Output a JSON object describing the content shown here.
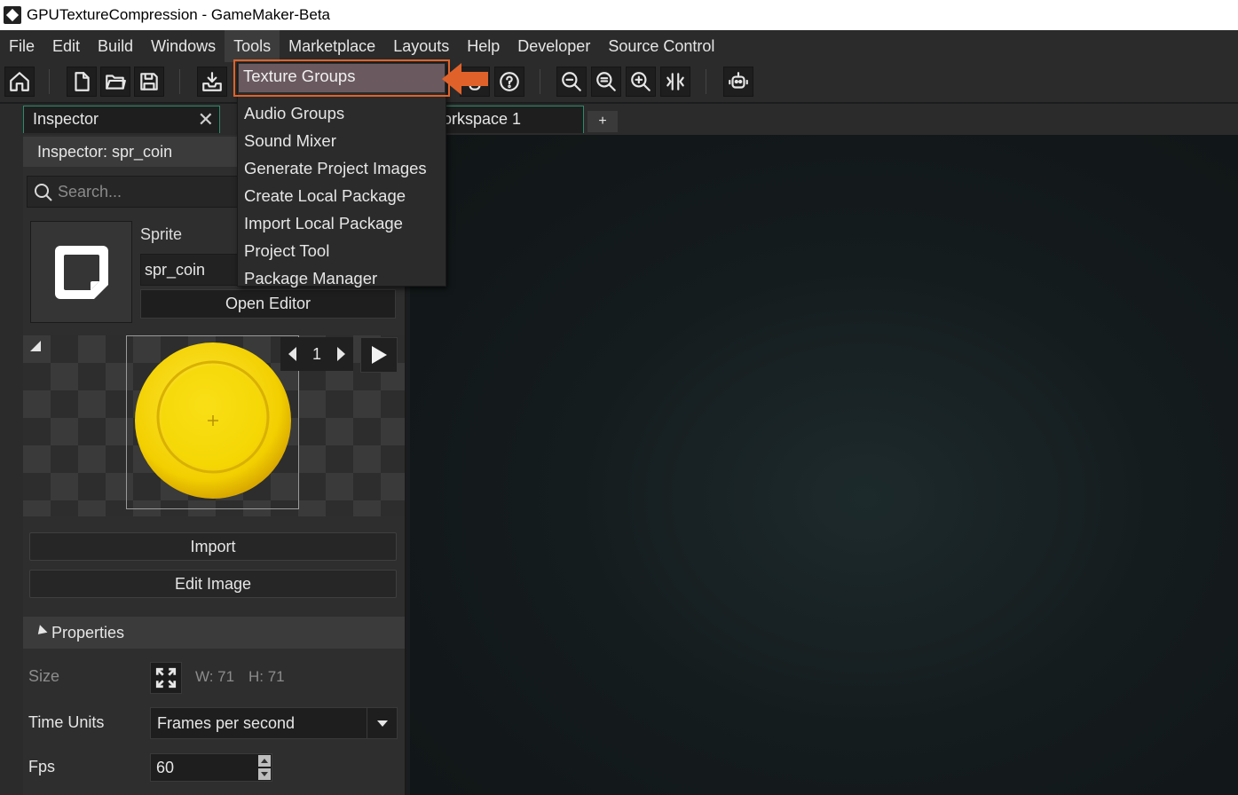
{
  "window": {
    "title": "GPUTextureCompression - GameMaker-Beta"
  },
  "menubar": {
    "items": [
      "File",
      "Edit",
      "Build",
      "Windows",
      "Tools",
      "Marketplace",
      "Layouts",
      "Help",
      "Developer",
      "Source Control"
    ],
    "active": "Tools"
  },
  "tabs": {
    "inspector": "Inspector",
    "workspace": "orkspace 1",
    "add": "+"
  },
  "inspector": {
    "header": "Inspector: spr_coin",
    "search_placeholder": "Search...",
    "sprite_label": "Sprite",
    "sprite_name": "spr_coin",
    "open_editor": "Open Editor",
    "frame_number": "1",
    "import": "Import",
    "edit_image": "Edit Image",
    "properties_header": "Properties",
    "size_label": "Size",
    "size_w": "W: 71",
    "size_h": "H: 71",
    "time_units_label": "Time Units",
    "time_units_value": "Frames per second",
    "fps_label": "Fps",
    "fps_value": "60"
  },
  "tools_menu": {
    "items": [
      "Texture Groups",
      "Audio Groups",
      "Sound Mixer",
      "Generate Project Images",
      "Create Local Package",
      "Import Local Package",
      "Project Tool",
      "Package Manager"
    ],
    "highlighted": "Texture Groups"
  },
  "colors": {
    "highlight_border": "#e0622a",
    "tab_accent": "#2c8a6a",
    "coin": "#f5d800"
  }
}
